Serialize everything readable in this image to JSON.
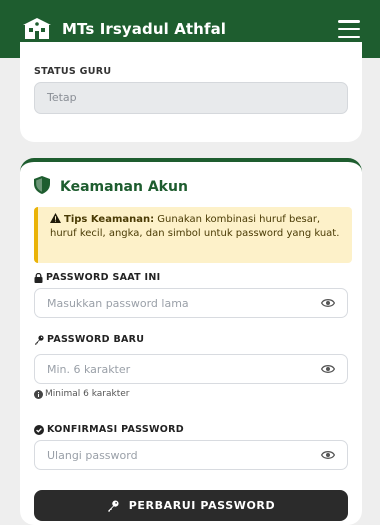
{
  "navbar": {
    "title": "MTs Irsyadul Athfal",
    "logo_icon": "school-building-icon",
    "menu_icon": "hamburger-menu-icon",
    "background": "#1e5d2f"
  },
  "status_card": {
    "label": "STATUS GURU",
    "value": "Tetap"
  },
  "security_card": {
    "title": "Keamanan Akun",
    "title_icon": "shield-icon",
    "accent": "#1e5d2f",
    "tips": {
      "icon": "warning-triangle-icon",
      "heading": "Tips Keamanan:",
      "text": "Gunakan kombinasi huruf besar, huruf kecil, angka, dan simbol untuk password yang kuat."
    },
    "fields": {
      "current": {
        "label": "PASSWORD SAAT INI",
        "icon": "lock-icon",
        "placeholder": "Masukkan password lama"
      },
      "new": {
        "label": "PASSWORD BARU",
        "icon": "key-icon",
        "placeholder": "Min. 6 karakter",
        "hint": "Minimal 6 karakter",
        "hint_icon": "info-circle-icon"
      },
      "confirm": {
        "label": "KONFIRMASI PASSWORD",
        "icon": "check-circle-icon",
        "placeholder": "Ulangi password"
      }
    },
    "submit": {
      "label": "PERBARUI PASSWORD",
      "icon": "key-icon"
    }
  }
}
